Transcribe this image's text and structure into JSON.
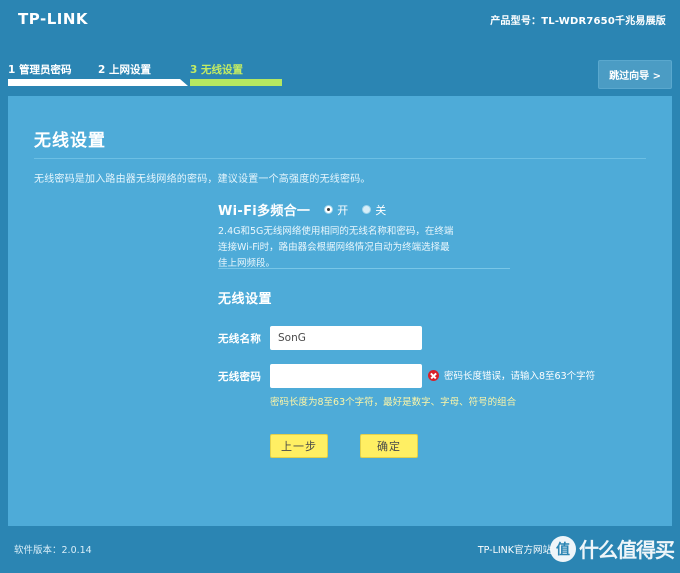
{
  "header": {
    "logo": "TP-LINK",
    "product_model": "产品型号：TL-WDR7650千兆易展版",
    "skip_button": "跳过向导 >"
  },
  "steps": [
    {
      "label": "1 管理员密码",
      "state": "done"
    },
    {
      "label": "2 上网设置",
      "state": "done"
    },
    {
      "label": "3 无线设置",
      "state": "active"
    }
  ],
  "panel": {
    "title": "无线设置",
    "subtitle": "无线密码是加入路由器无线网络的密码，建议设置一个高强度的无线密码。"
  },
  "wifi_band": {
    "label": "Wi-Fi多频合一",
    "options": [
      {
        "label": "开",
        "selected": true
      },
      {
        "label": "关",
        "selected": false
      }
    ],
    "description": "2.4G和5G无线网络使用相同的无线名称和密码，在终端连接Wi-Fi时，路由器会根据网络情况自动为终端选择最佳上网频段。"
  },
  "wireless": {
    "section_title": "无线设置",
    "ssid": {
      "label": "无线名称",
      "value": "SonG",
      "placeholder": ""
    },
    "password": {
      "label": "无线密码",
      "value": "",
      "placeholder": ""
    },
    "error": "密码长度错误，请输入8至63个字符",
    "hint": "密码长度为8至63个字符，最好是数字、字母、符号的组合"
  },
  "buttons": {
    "back": "上一步",
    "confirm": "确定"
  },
  "footer": {
    "version": "软件版本：2.0.14",
    "link": "TP-LINK官方网站",
    "watermark": "什么值得买",
    "watermark_logo": "值"
  },
  "colors": {
    "header_bg": "#2b85b3",
    "panel_bg": "#4eabd8",
    "step_active": "#b5e861",
    "step_done": "#ffffff",
    "button_yellow": "#ffef63",
    "error_red": "#d8202a",
    "hint_yellow": "#fdf6a8"
  }
}
